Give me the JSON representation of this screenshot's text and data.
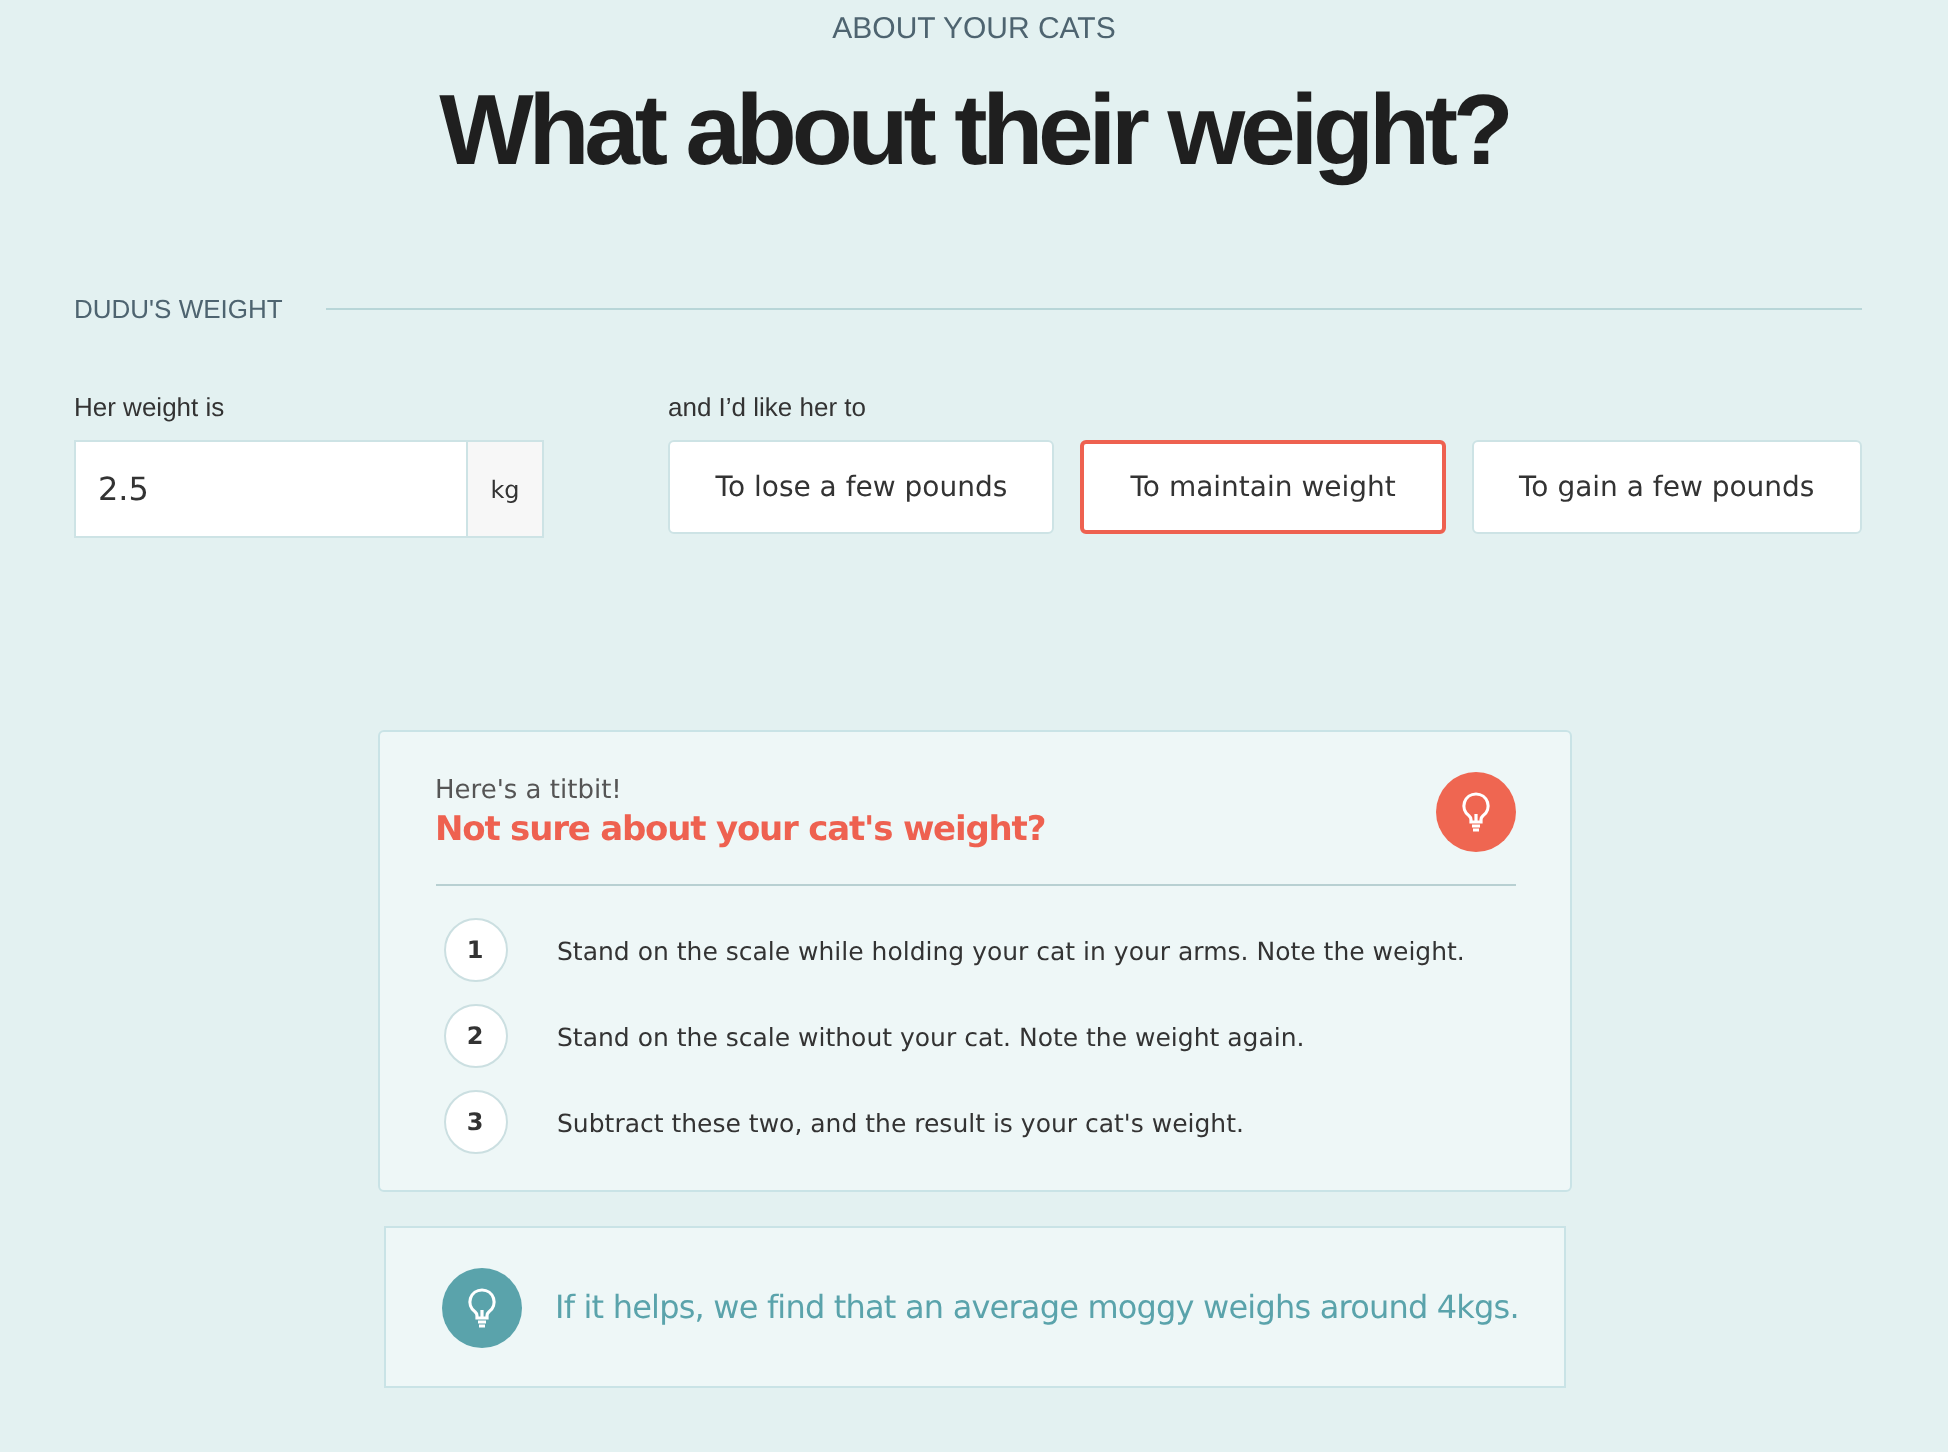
{
  "eyebrow": "ABOUT YOUR CATS",
  "heading": "What about their weight?",
  "section": {
    "title": "DUDU'S WEIGHT"
  },
  "weight_field": {
    "label": "Her weight is",
    "value": "2.5",
    "unit": "kg"
  },
  "goal": {
    "label": "and I’d like her to",
    "options": [
      {
        "label": "To lose a few pounds",
        "selected": false
      },
      {
        "label": "To maintain weight",
        "selected": true
      },
      {
        "label": "To gain a few pounds",
        "selected": false
      }
    ]
  },
  "tip_card": {
    "kicker": "Here's a titbit!",
    "title": "Not sure about your cat's weight?",
    "steps": [
      {
        "number": "1",
        "text": "Stand on the scale while holding your cat in your arms. Note the weight."
      },
      {
        "number": "2",
        "text": "Stand on the scale without your cat. Note the weight again."
      },
      {
        "number": "3",
        "text": "Subtract these two, and the result is your cat's weight."
      }
    ]
  },
  "hint": {
    "text": "If it helps, we find that an average moggy weighs around 4kgs."
  }
}
